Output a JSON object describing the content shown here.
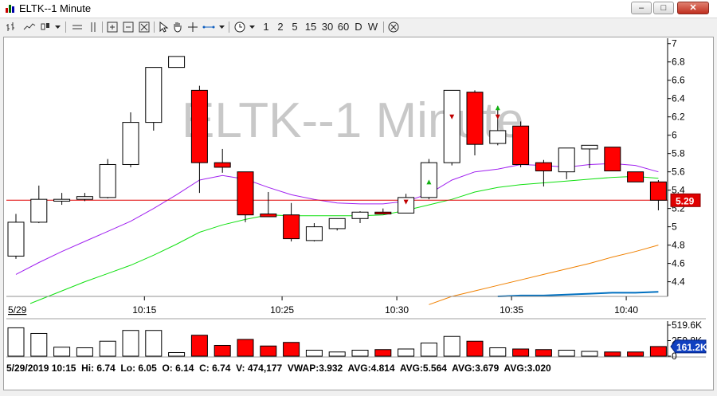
{
  "window": {
    "title": "ELTK--1 Minute",
    "minimize_label": "–",
    "maximize_label": "□",
    "close_label": "✕"
  },
  "toolbar": {
    "intervals": [
      "1",
      "2",
      "5",
      "15",
      "30",
      "60",
      "D",
      "W"
    ],
    "icons": [
      "bar-style-icon",
      "line-style-icon",
      "candle-style-icon",
      "dropdown-arrow-icon",
      "horizontal-lines-icon",
      "vertical-lines-icon",
      "zoom-in-icon",
      "zoom-out-icon",
      "zoom-fit-icon",
      "pointer-icon",
      "hand-pan-icon",
      "crosshair-icon",
      "measure-icon",
      "dropdown-arrow-icon",
      "clock-icon",
      "dropdown-arrow-icon",
      "close-circle-icon"
    ]
  },
  "chart": {
    "watermark": "ELTK--1 Minute",
    "current_price_label": "5.29",
    "volume_current_label": "161.2K",
    "date_label": "5/29",
    "colors": {
      "up": "#ffffff",
      "down": "#ff0000",
      "ma_purple": "#a020f0",
      "ma_green": "#10e010",
      "ma_orange": "#f08000",
      "ma_blue": "#0070c0",
      "price_line": "#e00000",
      "badge": "#e00000"
    }
  },
  "chart_data": {
    "type": "candlestick",
    "symbol": "ELTK",
    "interval": "1 Minute",
    "yticks": [
      4.4,
      4.6,
      4.8,
      5,
      5.2,
      5.4,
      5.6,
      5.8,
      6,
      6.2,
      6.4,
      6.6,
      6.8,
      7
    ],
    "ytick_labels": [
      "4.4",
      "4.6",
      "4.8",
      "5",
      "5.2",
      "5.4",
      "5.6",
      "5.8",
      "6",
      "6.2",
      "6.4",
      "6.6",
      "6.8",
      "7"
    ],
    "ylim": [
      4.24,
      7.05
    ],
    "xtick_labels": [
      "10:15",
      "10:25",
      "10:30",
      "10:35",
      "10:40"
    ],
    "xtick_index": [
      5.6,
      11.6,
      16.6,
      21.6,
      26.6
    ],
    "volume_tick_labels": [
      "519.6K",
      "259.8K",
      "0"
    ],
    "volume_ylim": [
      0,
      519.6
    ],
    "last_price": 5.29,
    "candles": [
      {
        "o": 4.68,
        "h": 5.14,
        "l": 4.65,
        "c": 5.05
      },
      {
        "o": 5.05,
        "h": 5.45,
        "l": 5.04,
        "c": 5.3
      },
      {
        "o": 5.28,
        "h": 5.37,
        "l": 5.24,
        "c": 5.3
      },
      {
        "o": 5.3,
        "h": 5.37,
        "l": 5.28,
        "c": 5.33
      },
      {
        "o": 5.32,
        "h": 5.74,
        "l": 5.31,
        "c": 5.68
      },
      {
        "o": 5.68,
        "h": 6.25,
        "l": 5.65,
        "c": 6.14
      },
      {
        "o": 6.14,
        "h": 6.74,
        "l": 6.05,
        "c": 6.74
      },
      {
        "o": 6.74,
        "h": 6.86,
        "l": 6.74,
        "c": 6.86
      },
      {
        "o": 6.49,
        "h": 6.54,
        "l": 5.37,
        "c": 5.7
      },
      {
        "o": 5.7,
        "h": 5.85,
        "l": 5.59,
        "c": 5.65
      },
      {
        "o": 5.6,
        "h": 5.6,
        "l": 5.05,
        "c": 5.13
      },
      {
        "o": 5.14,
        "h": 5.38,
        "l": 5.12,
        "c": 5.11
      },
      {
        "o": 5.13,
        "h": 5.26,
        "l": 4.84,
        "c": 4.87
      },
      {
        "o": 4.85,
        "h": 5.04,
        "l": 4.84,
        "c": 5.0
      },
      {
        "o": 4.98,
        "h": 5.09,
        "l": 4.96,
        "c": 5.09
      },
      {
        "o": 5.09,
        "h": 5.17,
        "l": 5.04,
        "c": 5.16
      },
      {
        "o": 5.16,
        "h": 5.2,
        "l": 5.14,
        "c": 5.14
      },
      {
        "o": 5.15,
        "h": 5.36,
        "l": 5.15,
        "c": 5.32
      },
      {
        "o": 5.32,
        "h": 5.74,
        "l": 5.3,
        "c": 5.7
      },
      {
        "o": 5.7,
        "h": 6.49,
        "l": 5.67,
        "c": 6.49
      },
      {
        "o": 6.47,
        "h": 6.49,
        "l": 5.78,
        "c": 5.9
      },
      {
        "o": 5.91,
        "h": 6.32,
        "l": 5.89,
        "c": 6.05
      },
      {
        "o": 6.1,
        "h": 6.15,
        "l": 5.65,
        "c": 5.68
      },
      {
        "o": 5.7,
        "h": 5.73,
        "l": 5.44,
        "c": 5.61
      },
      {
        "o": 5.6,
        "h": 5.86,
        "l": 5.52,
        "c": 5.86
      },
      {
        "o": 5.85,
        "h": 5.89,
        "l": 5.64,
        "c": 5.89
      },
      {
        "o": 5.87,
        "h": 5.87,
        "l": 5.61,
        "c": 5.61
      },
      {
        "o": 5.6,
        "h": 5.6,
        "l": 5.5,
        "c": 5.49
      },
      {
        "o": 5.49,
        "h": 5.51,
        "l": 5.18,
        "c": 5.29
      }
    ],
    "volume": [
      474,
      380,
      150,
      140,
      250,
      430,
      430,
      60,
      350,
      180,
      280,
      170,
      230,
      100,
      70,
      100,
      110,
      120,
      220,
      330,
      250,
      140,
      120,
      110,
      100,
      80,
      70,
      70,
      161.2
    ],
    "series": [
      {
        "name": "AVG",
        "color": "#a020f0",
        "values": [
          4.48,
          4.61,
          4.73,
          4.84,
          4.95,
          5.06,
          5.2,
          5.35,
          5.51,
          5.56,
          5.52,
          5.43,
          5.35,
          5.3,
          5.26,
          5.25,
          5.25,
          5.28,
          5.36,
          5.51,
          5.6,
          5.63,
          5.68,
          5.67,
          5.65,
          5.68,
          5.69,
          5.67,
          5.6
        ]
      },
      {
        "name": "AVG",
        "color": "#10e010",
        "values": [
          4.1,
          4.2,
          4.3,
          4.4,
          4.49,
          4.58,
          4.69,
          4.81,
          4.94,
          5.02,
          5.08,
          5.13,
          5.12,
          5.12,
          5.12,
          5.12,
          5.13,
          5.18,
          5.24,
          5.3,
          5.38,
          5.43,
          5.46,
          5.48,
          5.5,
          5.52,
          5.54,
          5.55,
          5.53
        ]
      },
      {
        "name": "AVG",
        "color": "#f08000",
        "values": [
          null,
          null,
          null,
          null,
          null,
          null,
          null,
          null,
          null,
          null,
          null,
          null,
          null,
          null,
          null,
          null,
          null,
          null,
          4.15,
          4.24,
          4.3,
          4.36,
          4.42,
          4.48,
          4.54,
          4.6,
          4.67,
          4.73,
          4.8
        ]
      },
      {
        "name": "AVG",
        "color": "#0070c0",
        "values": [
          null,
          null,
          null,
          null,
          null,
          null,
          null,
          null,
          null,
          null,
          null,
          null,
          null,
          null,
          null,
          null,
          null,
          null,
          null,
          null,
          null,
          4.24,
          4.25,
          4.25,
          4.26,
          4.27,
          4.28,
          4.28,
          4.29
        ]
      }
    ],
    "markers": [
      {
        "index": 17,
        "type": "sell",
        "price": 5.27
      },
      {
        "index": 18,
        "type": "buy",
        "price": 5.49
      },
      {
        "index": 19,
        "type": "sell",
        "price": 6.2
      },
      {
        "index": 21,
        "type": "sell",
        "price": 6.2
      },
      {
        "index": 21,
        "type": "buy",
        "price": 6.3
      }
    ],
    "status_line": "5/29/2019 10:15  Hi: 6.74  Lo: 6.05  O: 6.14  C: 6.74  V: 474,177  VWAP:3.932  AVG:4.814  AVG:5.564  AVG:3.679  AVG:3.020"
  }
}
